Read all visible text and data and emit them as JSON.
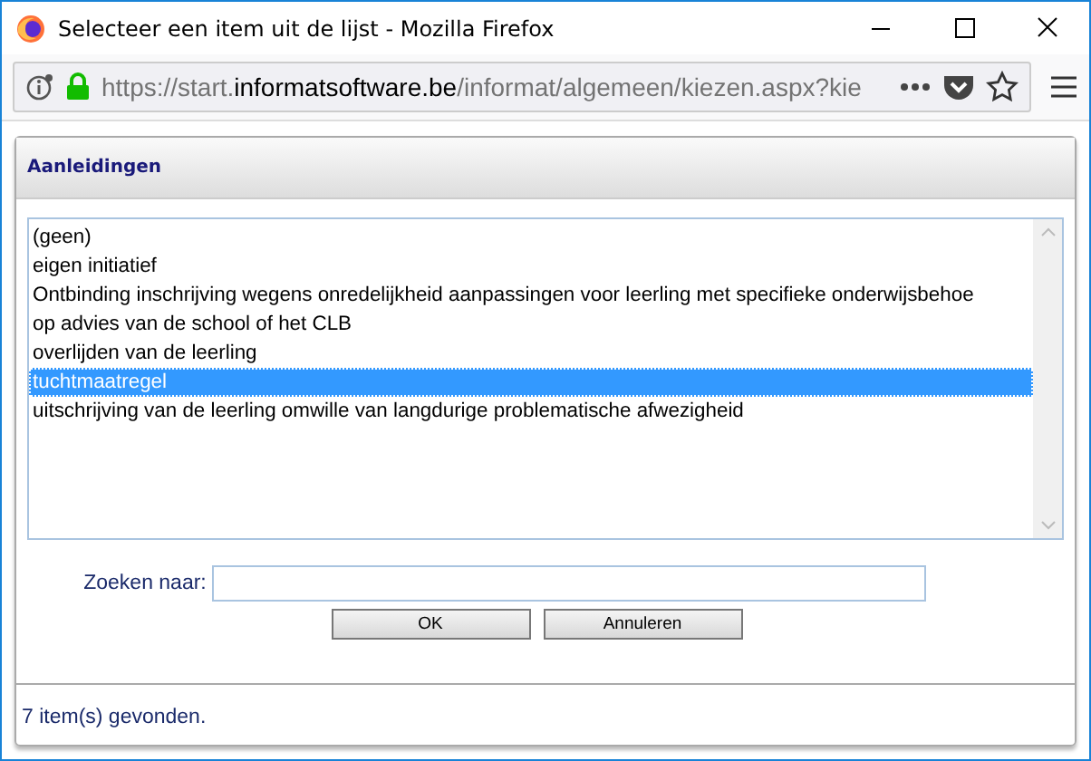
{
  "window": {
    "title": "Selecteer een item uit de lijst - Mozilla Firefox"
  },
  "address_bar": {
    "url_prefix": "https://start.",
    "url_domain": "informatsoftware.be",
    "url_path": "/informat/algemeen/kiezen.aspx?kie"
  },
  "panel": {
    "title": "Aanleidingen"
  },
  "list": {
    "items": [
      {
        "label": "(geen)",
        "selected": false
      },
      {
        "label": "eigen initiatief",
        "selected": false
      },
      {
        "label": "Ontbinding inschrijving wegens onredelijkheid aanpassingen voor leerling met specifieke onderwijsbehoe",
        "selected": false
      },
      {
        "label": "op advies van de school of het CLB",
        "selected": false
      },
      {
        "label": "overlijden van de leerling",
        "selected": false
      },
      {
        "label": "tuchtmaatregel",
        "selected": true
      },
      {
        "label": "uitschrijving van de leerling omwille van langdurige problematische afwezigheid",
        "selected": false
      }
    ]
  },
  "search": {
    "label": "Zoeken naar:"
  },
  "buttons": [
    "OK",
    "Annuleren"
  ],
  "status_bar": "7 item(s) gevonden."
}
